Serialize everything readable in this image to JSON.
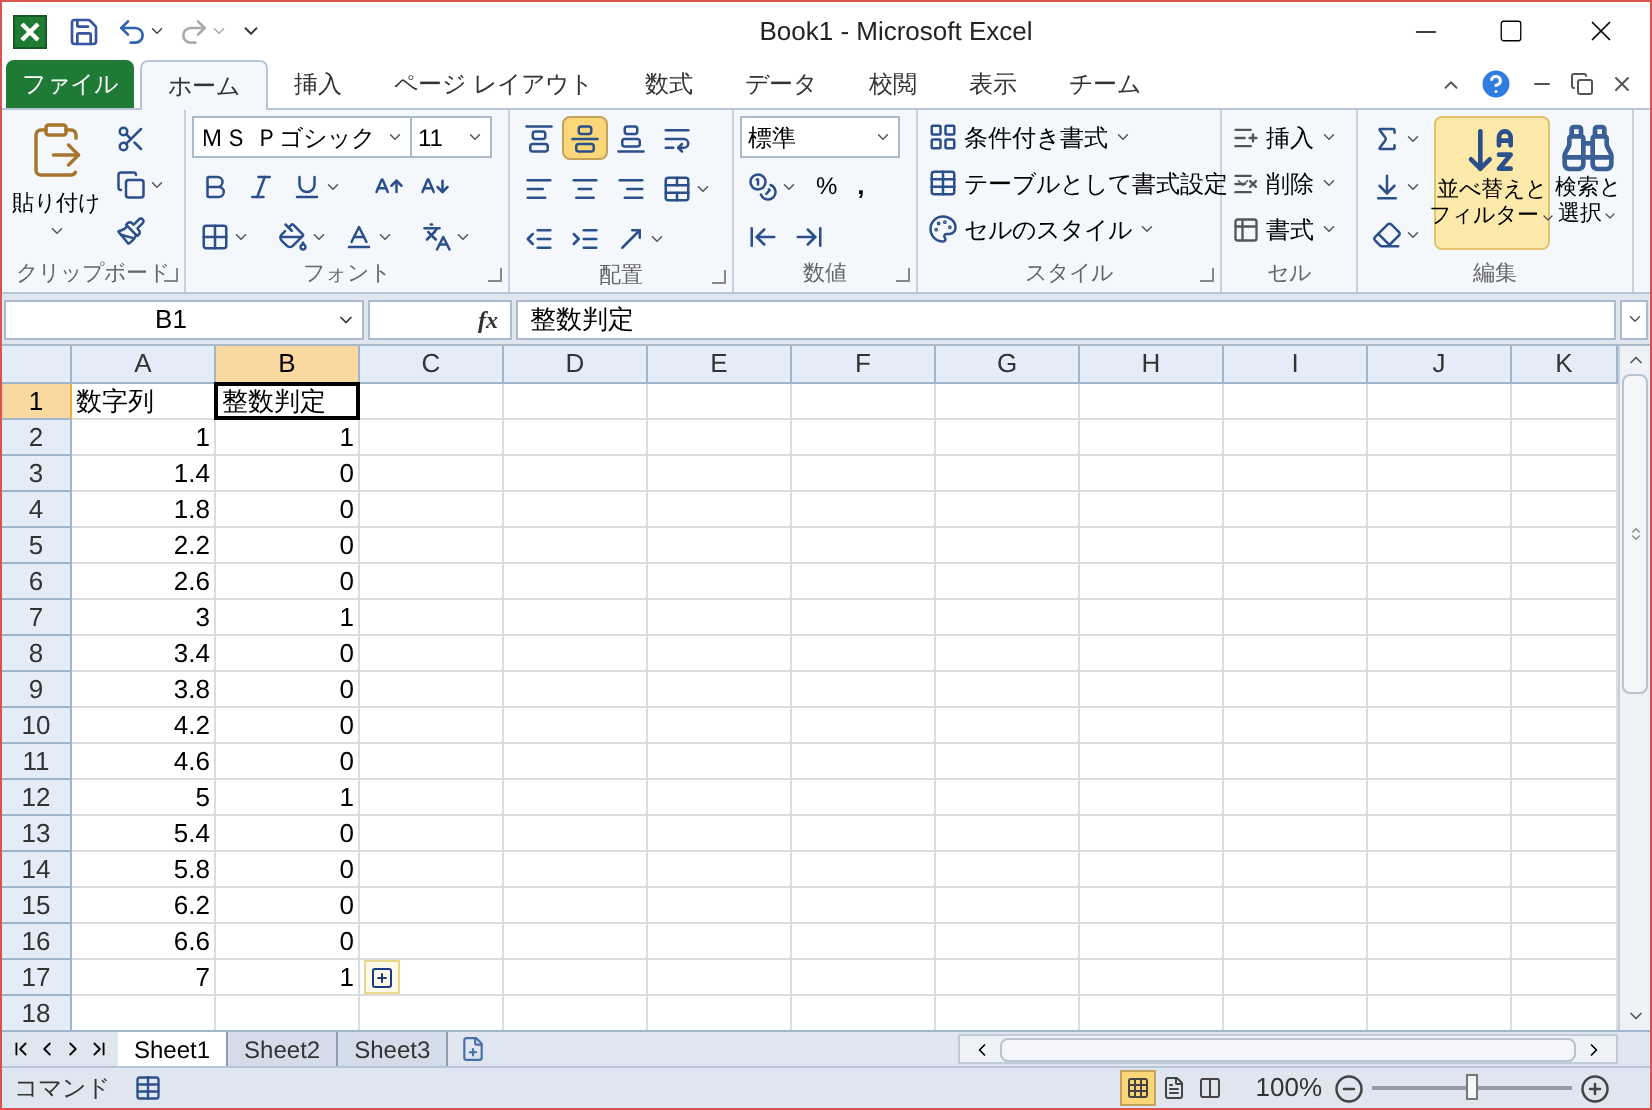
{
  "title_bar": {
    "title": "Book1 - Microsoft Excel"
  },
  "ribbon_tabs": [
    {
      "label": "ファイル",
      "kind": "file",
      "selected": false
    },
    {
      "label": "ホーム",
      "kind": "tab",
      "selected": true
    },
    {
      "label": "挿入",
      "kind": "tab",
      "selected": false
    },
    {
      "label": "ページ レイアウト",
      "kind": "tab",
      "selected": false
    },
    {
      "label": "数式",
      "kind": "tab",
      "selected": false
    },
    {
      "label": "データ",
      "kind": "tab",
      "selected": false
    },
    {
      "label": "校閲",
      "kind": "tab",
      "selected": false
    },
    {
      "label": "表示",
      "kind": "tab",
      "selected": false
    },
    {
      "label": "チーム",
      "kind": "tab",
      "selected": false
    }
  ],
  "clipboard": {
    "label": "クリップボード",
    "paste": "貼り付け"
  },
  "font": {
    "label": "フォント",
    "name": "ＭＳ Ｐゴシック",
    "size": "11"
  },
  "alignment": {
    "label": "配置",
    "buttons": [
      {
        "kind": "top",
        "selected": false
      },
      {
        "kind": "middle",
        "selected": true
      },
      {
        "kind": "bottom",
        "selected": false
      },
      {
        "kind": "wrap",
        "selected": false
      },
      {
        "kind": "left",
        "selected": false
      },
      {
        "kind": "center",
        "selected": false
      },
      {
        "kind": "right",
        "selected": false
      },
      {
        "kind": "merge",
        "selected": false
      },
      {
        "kind": "outdent",
        "selected": false
      },
      {
        "kind": "indent",
        "selected": false
      },
      {
        "kind": "orientation",
        "selected": false
      }
    ]
  },
  "number": {
    "label": "数値",
    "format": "標準",
    "percent": "%",
    "comma": ","
  },
  "styles": {
    "label": "スタイル",
    "items": [
      "条件付き書式",
      "テーブルとして書式設定",
      "セルのスタイル"
    ]
  },
  "cells": {
    "label": "セル",
    "items": [
      "挿入",
      "削除",
      "書式"
    ]
  },
  "editing": {
    "label": "編集",
    "sort_filter": [
      "並べ替えと",
      "フィルター"
    ],
    "sort_filter_highlighted": true,
    "find_select": [
      "検索と",
      "選択"
    ]
  },
  "formula_bar": {
    "name_box": "B1",
    "function_label": "fx",
    "content": "整数判定"
  },
  "columns": [
    {
      "label": "A",
      "selected": false
    },
    {
      "label": "B",
      "selected": true
    },
    {
      "label": "C",
      "selected": false
    },
    {
      "label": "D",
      "selected": false
    },
    {
      "label": "E",
      "selected": false
    },
    {
      "label": "F",
      "selected": false
    },
    {
      "label": "G",
      "selected": false
    },
    {
      "label": "H",
      "selected": false
    },
    {
      "label": "I",
      "selected": false
    },
    {
      "label": "J",
      "selected": false
    },
    {
      "label": "K",
      "selected": false
    }
  ],
  "rows": [
    {
      "label": "1",
      "selected": true,
      "cells": [
        {
          "text": "数字列",
          "kind": "text",
          "active": false
        },
        {
          "text": "整数判定",
          "kind": "text",
          "active": true
        }
      ]
    },
    {
      "label": "2",
      "selected": false,
      "cells": [
        {
          "text": "1",
          "kind": "number",
          "active": false
        },
        {
          "text": "1",
          "kind": "number",
          "active": false
        }
      ]
    },
    {
      "label": "3",
      "selected": false,
      "cells": [
        {
          "text": "1.4",
          "kind": "number",
          "active": false
        },
        {
          "text": "0",
          "kind": "number",
          "active": false
        }
      ]
    },
    {
      "label": "4",
      "selected": false,
      "cells": [
        {
          "text": "1.8",
          "kind": "number",
          "active": false
        },
        {
          "text": "0",
          "kind": "number",
          "active": false
        }
      ]
    },
    {
      "label": "5",
      "selected": false,
      "cells": [
        {
          "text": "2.2",
          "kind": "number",
          "active": false
        },
        {
          "text": "0",
          "kind": "number",
          "active": false
        }
      ]
    },
    {
      "label": "6",
      "selected": false,
      "cells": [
        {
          "text": "2.6",
          "kind": "number",
          "active": false
        },
        {
          "text": "0",
          "kind": "number",
          "active": false
        }
      ]
    },
    {
      "label": "7",
      "selected": false,
      "cells": [
        {
          "text": "3",
          "kind": "number",
          "active": false
        },
        {
          "text": "1",
          "kind": "number",
          "active": false
        }
      ]
    },
    {
      "label": "8",
      "selected": false,
      "cells": [
        {
          "text": "3.4",
          "kind": "number",
          "active": false
        },
        {
          "text": "0",
          "kind": "number",
          "active": false
        }
      ]
    },
    {
      "label": "9",
      "selected": false,
      "cells": [
        {
          "text": "3.8",
          "kind": "number",
          "active": false
        },
        {
          "text": "0",
          "kind": "number",
          "active": false
        }
      ]
    },
    {
      "label": "10",
      "selected": false,
      "cells": [
        {
          "text": "4.2",
          "kind": "number",
          "active": false
        },
        {
          "text": "0",
          "kind": "number",
          "active": false
        }
      ]
    },
    {
      "label": "11",
      "selected": false,
      "cells": [
        {
          "text": "4.6",
          "kind": "number",
          "active": false
        },
        {
          "text": "0",
          "kind": "number",
          "active": false
        }
      ]
    },
    {
      "label": "12",
      "selected": false,
      "cells": [
        {
          "text": "5",
          "kind": "number",
          "active": false
        },
        {
          "text": "1",
          "kind": "number",
          "active": false
        }
      ]
    },
    {
      "label": "13",
      "selected": false,
      "cells": [
        {
          "text": "5.4",
          "kind": "number",
          "active": false
        },
        {
          "text": "0",
          "kind": "number",
          "active": false
        }
      ]
    },
    {
      "label": "14",
      "selected": false,
      "cells": [
        {
          "text": "5.8",
          "kind": "number",
          "active": false
        },
        {
          "text": "0",
          "kind": "number",
          "active": false
        }
      ]
    },
    {
      "label": "15",
      "selected": false,
      "cells": [
        {
          "text": "6.2",
          "kind": "number",
          "active": false
        },
        {
          "text": "0",
          "kind": "number",
          "active": false
        }
      ]
    },
    {
      "label": "16",
      "selected": false,
      "cells": [
        {
          "text": "6.6",
          "kind": "number",
          "active": false
        },
        {
          "text": "0",
          "kind": "number",
          "active": false
        }
      ]
    },
    {
      "label": "17",
      "selected": false,
      "paste_options": true,
      "cells": [
        {
          "text": "7",
          "kind": "number",
          "active": false
        },
        {
          "text": "1",
          "kind": "number",
          "active": false
        }
      ]
    },
    {
      "label": "18",
      "selected": false,
      "cells": []
    }
  ],
  "sheet_tabs": [
    {
      "label": "Sheet1",
      "selected": true
    },
    {
      "label": "Sheet2",
      "selected": false
    },
    {
      "label": "Sheet3",
      "selected": false
    }
  ],
  "status_bar": {
    "mode": "コマンド",
    "views": [
      {
        "kind": "normal",
        "selected": true
      },
      {
        "kind": "page_layout",
        "selected": false
      },
      {
        "kind": "page_break",
        "selected": false
      }
    ],
    "zoom": "100%",
    "zoom_slider": {
      "level": 0.5
    }
  }
}
